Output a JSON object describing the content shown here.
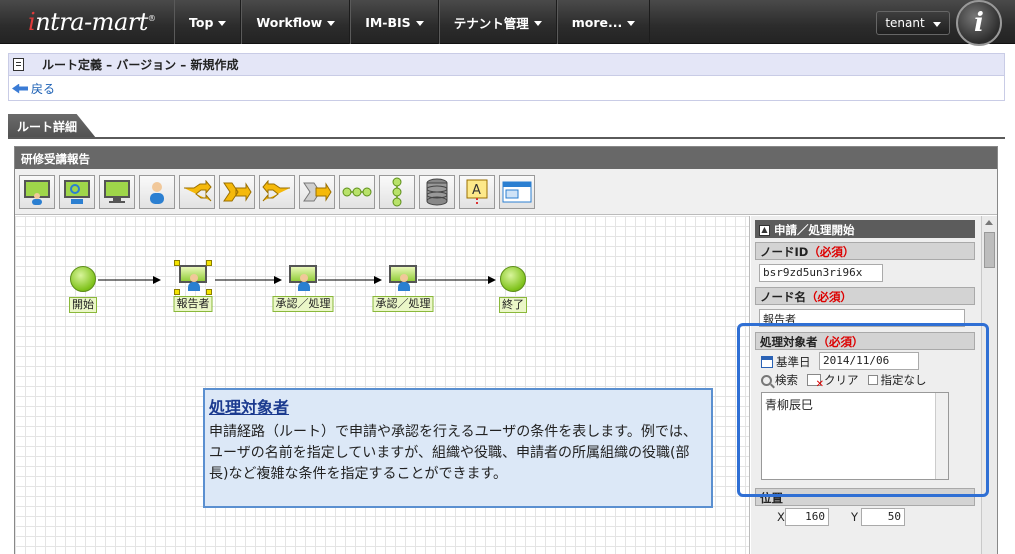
{
  "nav": {
    "logo": "intra-mart",
    "logo_mark": "®",
    "menu": [
      "Top",
      "Workflow",
      "IM-BIS",
      "テナント管理",
      "more..."
    ],
    "tenant": "tenant",
    "user_initial": "i"
  },
  "page": {
    "title": "ルート定義 – バージョン – 新規作成",
    "back": "戻る",
    "tab": "ルート詳細"
  },
  "editor": {
    "title": "研修受講報告",
    "palette": [
      "start-user-node",
      "approval-node",
      "monitor-node",
      "user-node",
      "branch-node",
      "merge-node",
      "split-node",
      "join-node",
      "line-node",
      "vertical-node",
      "db-node",
      "text-node",
      "window-node"
    ],
    "nodes": {
      "start": "開始",
      "report": "報告者",
      "approve1": "承認／処理",
      "approve2": "承認／処理",
      "end": "終了"
    }
  },
  "callout": {
    "title": "処理対象者",
    "body": "申請経路（ルート）で申請や承認を行えるユーザの条件を表します。例では、ユーザの名前を指定していますが、組織や役職、申請者の所属組織の役職(部長)など複雑な条件を指定することができます。"
  },
  "props": {
    "section": "申請／処理開始",
    "node_id_label": "ノードID",
    "node_id_value": "bsr9zd5un3ri96x",
    "node_name_label": "ノード名",
    "node_name_value": "報告者",
    "required": "（必須）",
    "target_label": "処理対象者",
    "base_date_label": "基準日",
    "base_date_value": "2014/11/06",
    "search": "検索",
    "clear": "クリア",
    "no_spec": "指定なし",
    "target_value": "青柳辰巳",
    "position_label": "位置",
    "x_label": "X",
    "x_value": "160",
    "y_label": "Y",
    "y_value": "50"
  },
  "colors": {
    "accent": "#2f6fd4",
    "required": "#dd0000",
    "node_green": "#7fc21b"
  }
}
